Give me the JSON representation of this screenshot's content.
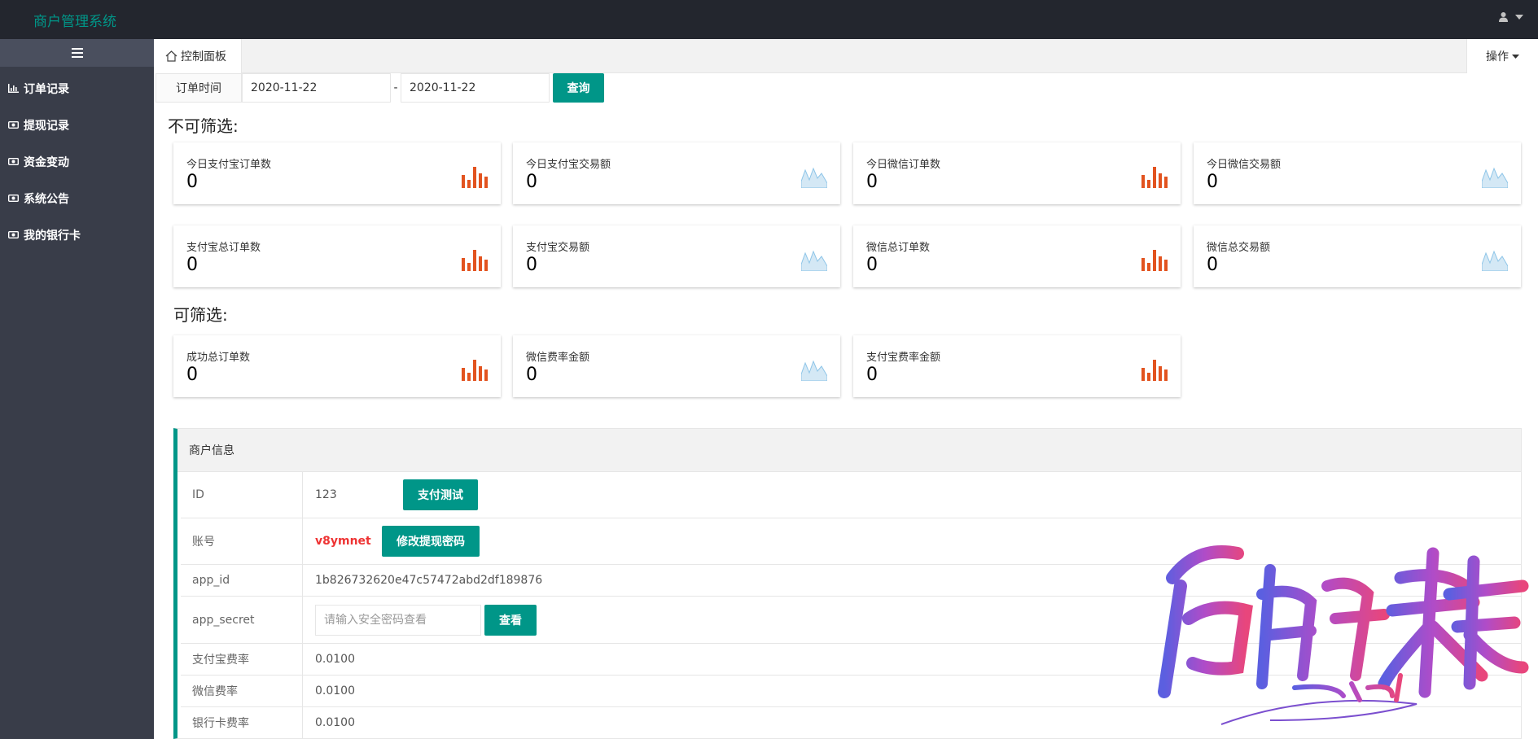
{
  "header": {
    "app_title": "商户管理系统"
  },
  "sidebar": {
    "items": [
      {
        "label": "订单记录",
        "icon": "bar-chart-icon"
      },
      {
        "label": "提现记录",
        "icon": "money-icon"
      },
      {
        "label": "资金变动",
        "icon": "money-icon"
      },
      {
        "label": "系统公告",
        "icon": "money-icon"
      },
      {
        "label": "我的银行卡",
        "icon": "money-icon"
      }
    ]
  },
  "tabs": {
    "home_label": "控制面板",
    "ops_label": "操作"
  },
  "filter": {
    "label": "订单时间",
    "start_date": "2020-11-22",
    "separator": "-",
    "end_date": "2020-11-22",
    "query_label": "查询"
  },
  "sections": {
    "unfiltered": "不可筛选:",
    "filtered": "可筛选:"
  },
  "stats_row1": [
    {
      "label": "今日支付宝订单数",
      "value": "0",
      "icon": "bar-chart-icon"
    },
    {
      "label": "今日支付宝交易额",
      "value": "0",
      "icon": "area-chart-icon"
    },
    {
      "label": "今日微信订单数",
      "value": "0",
      "icon": "bar-chart-icon"
    },
    {
      "label": "今日微信交易额",
      "value": "0",
      "icon": "area-chart-icon"
    }
  ],
  "stats_row2": [
    {
      "label": "支付宝总订单数",
      "value": "0",
      "icon": "bar-chart-icon"
    },
    {
      "label": "支付宝交易额",
      "value": "0",
      "icon": "area-chart-icon"
    },
    {
      "label": "微信总订单数",
      "value": "0",
      "icon": "bar-chart-icon"
    },
    {
      "label": "微信总交易额",
      "value": "0",
      "icon": "area-chart-icon"
    }
  ],
  "stats_row3": [
    {
      "label": "成功总订单数",
      "value": "0",
      "icon": "bar-chart-icon"
    },
    {
      "label": "微信费率金额",
      "value": "0",
      "icon": "area-chart-icon"
    },
    {
      "label": "支付宝费率金额",
      "value": "0",
      "icon": "bar-chart-icon"
    }
  ],
  "merchant": {
    "title": "商户信息",
    "id_label": "ID",
    "id_value": "123",
    "pay_test_label": "支付测试",
    "account_label": "账号",
    "account_value": "v8ymnet",
    "change_pwd_label": "修改提现密码",
    "app_id_label": "app_id",
    "app_id_value": "1b826732620e47c57472abd2df189876",
    "app_secret_label": "app_secret",
    "secret_placeholder": "请输入安全密码查看",
    "view_label": "查看",
    "alipay_rate_label": "支付宝费率",
    "alipay_rate_value": "0.0100",
    "wechat_rate_label": "微信费率",
    "wechat_rate_value": "0.0100",
    "bank_rate_label": "银行卡费率",
    "bank_rate_value": "0.0100"
  },
  "colors": {
    "accent": "#009688",
    "header_bg": "#23262e",
    "sidebar_bg": "#393d49",
    "bar_icon": "#e2531f",
    "area_icon": "#8ec5e8"
  }
}
